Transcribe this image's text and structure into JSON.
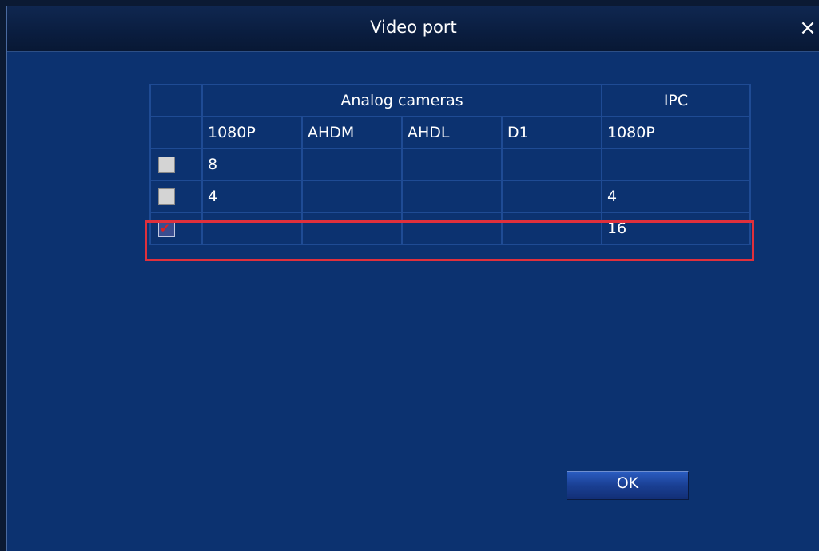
{
  "dialog": {
    "title": "Video port",
    "close_symbol": "×"
  },
  "table": {
    "group_headers": {
      "analog": "Analog cameras",
      "ipc": "IPC"
    },
    "columns": [
      "1080P",
      "AHDM",
      "AHDL",
      "D1",
      "1080P"
    ],
    "rows": [
      {
        "checked": false,
        "cells": [
          "8",
          "",
          "",
          "",
          ""
        ]
      },
      {
        "checked": false,
        "cells": [
          "4",
          "",
          "",
          "",
          "4"
        ]
      },
      {
        "checked": true,
        "cells": [
          "",
          "",
          "",
          "",
          "16"
        ]
      }
    ]
  },
  "buttons": {
    "ok_label": "OK"
  },
  "colors": {
    "background": "#0c3270",
    "grid_line": "#1f4b94",
    "highlight": "#e0303c"
  },
  "icons": {
    "close": "close-icon",
    "checked_mark": "checkmark-icon"
  }
}
